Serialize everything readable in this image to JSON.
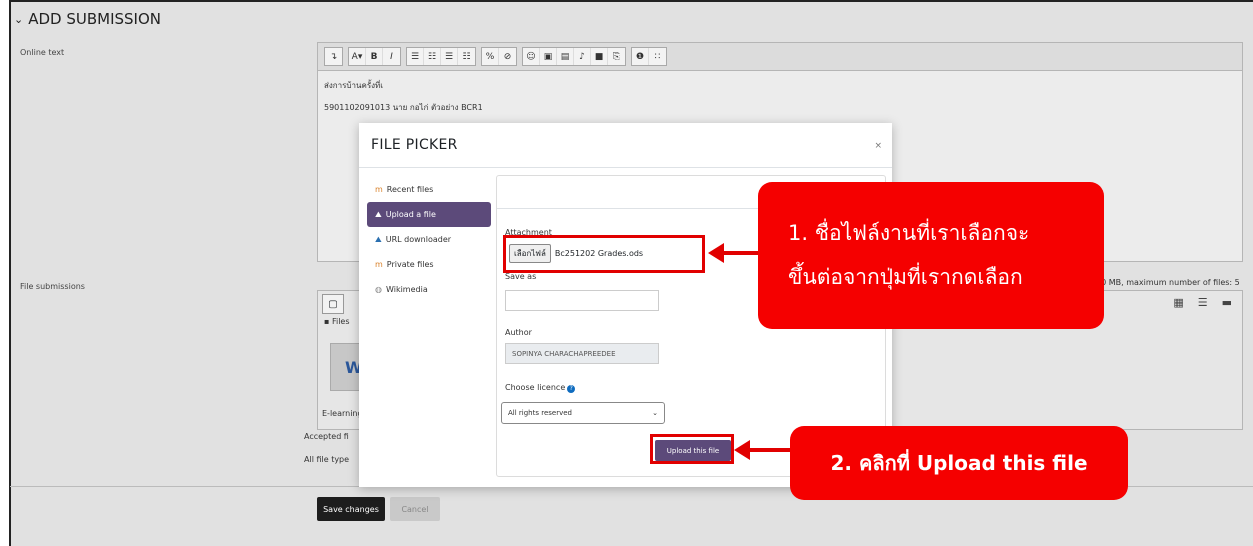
{
  "section": {
    "title": "ADD SUBMISSION",
    "chevron": "chevron-down-icon"
  },
  "online_text": {
    "label": "Online text",
    "toolbar_icons": [
      "↴",
      "A▾",
      "B",
      "I",
      "☰",
      "☷",
      "☰",
      "☷",
      "%",
      "⊘",
      "☺",
      "▣",
      "▤",
      "♪",
      "■",
      "⎘",
      "❶",
      "∷"
    ],
    "content_line1": "ส่งการบ้านครั้งที่เ",
    "content_line2": "5901102091013 นาย กอไก่ ตัวอย่าง BCR1"
  },
  "file_submissions": {
    "label": "File submissions",
    "folder_path": "Files",
    "file_name": "E-learning",
    "limit_text": "00 MB, maximum number of files: 5",
    "accepted_text": "Accepted fi",
    "all_types_text": "All file type"
  },
  "buttons": {
    "save": "Save changes",
    "cancel": "Cancel"
  },
  "modal": {
    "title": "FILE PICKER",
    "close": "×",
    "repositories": [
      {
        "label": "Recent files",
        "icon": "m-icon"
      },
      {
        "label": "Upload a file",
        "icon": "upload-icon"
      },
      {
        "label": "URL downloader",
        "icon": "url-icon"
      },
      {
        "label": "Private files",
        "icon": "m-icon"
      },
      {
        "label": "Wikimedia",
        "icon": "wikimedia-icon"
      }
    ],
    "attachment_label": "Attachment",
    "choose_button": "เลือกไฟล์",
    "chosen_file": "Bc251202 Grades.ods",
    "save_as_label": "Save as",
    "save_as_value": "",
    "author_label": "Author",
    "author_value": "SOPINYA CHARACHAPREEDEE",
    "licence_label": "Choose licence",
    "licence_value": "All rights reserved",
    "upload_button": "Upload this file"
  },
  "callouts": {
    "one_line1": "1. ชื่อไฟล์งานที่เราเลือกจะ",
    "one_line2": "ขึ้นต่อจากปุ่มที่เรากดเลือก",
    "two": "2. คลิกที่ Upload this file"
  },
  "colors": {
    "callout_red": "#f50000",
    "modal_accent": "#5c4a7a"
  }
}
